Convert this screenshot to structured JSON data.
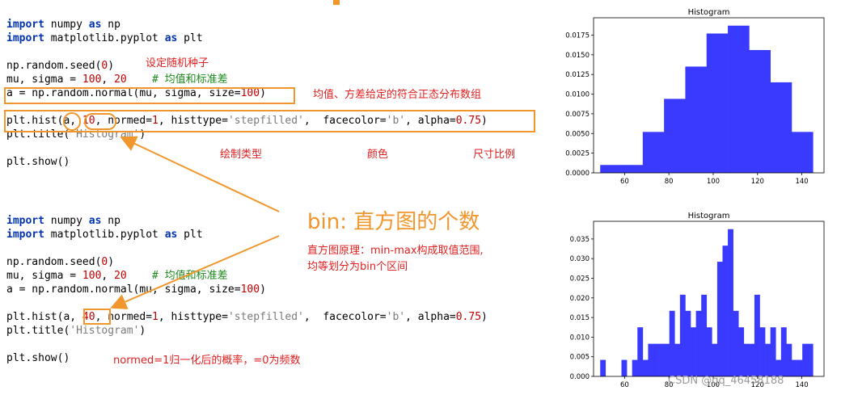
{
  "block1": {
    "lines": [
      {
        "parts": [
          {
            "t": "import",
            "c": "kw"
          },
          {
            "t": " numpy "
          },
          {
            "t": "as",
            "c": "kw"
          },
          {
            "t": " np"
          }
        ]
      },
      {
        "parts": [
          {
            "t": "import",
            "c": "kw"
          },
          {
            "t": " matplotlib.pyplot "
          },
          {
            "t": "as",
            "c": "kw"
          },
          {
            "t": " plt"
          }
        ]
      },
      {
        "parts": []
      },
      {
        "parts": [
          {
            "t": "np.random.seed("
          },
          {
            "t": "0",
            "c": "num"
          },
          {
            "t": ")"
          }
        ]
      },
      {
        "parts": [
          {
            "t": "mu, sigma = "
          },
          {
            "t": "100",
            "c": "num"
          },
          {
            "t": ", "
          },
          {
            "t": "20",
            "c": "num"
          },
          {
            "t": "    "
          },
          {
            "t": "# 均值和标准差",
            "c": "cm"
          }
        ]
      },
      {
        "parts": [
          {
            "t": "a = np.random.normal(mu, sigma, size="
          },
          {
            "t": "100",
            "c": "num"
          },
          {
            "t": ")"
          }
        ]
      },
      {
        "parts": []
      },
      {
        "parts": [
          {
            "t": "plt.hist(a, "
          },
          {
            "t": "10",
            "c": "num"
          },
          {
            "t": ", normed="
          },
          {
            "t": "1",
            "c": "num"
          },
          {
            "t": ", histtype="
          },
          {
            "t": "'stepfilled'",
            "c": "str"
          },
          {
            "t": ",  facecolor="
          },
          {
            "t": "'b'",
            "c": "str"
          },
          {
            "t": ", alpha="
          },
          {
            "t": "0.75",
            "c": "num"
          },
          {
            "t": ")"
          }
        ]
      },
      {
        "parts": [
          {
            "t": "plt.title("
          },
          {
            "t": "'Histogram'",
            "c": "str"
          },
          {
            "t": ")"
          }
        ]
      },
      {
        "parts": []
      },
      {
        "parts": [
          {
            "t": "plt.show()"
          }
        ]
      }
    ]
  },
  "block2": {
    "lines": [
      {
        "parts": [
          {
            "t": "import",
            "c": "kw"
          },
          {
            "t": " numpy "
          },
          {
            "t": "as",
            "c": "kw"
          },
          {
            "t": " np"
          }
        ]
      },
      {
        "parts": [
          {
            "t": "import",
            "c": "kw"
          },
          {
            "t": " matplotlib.pyplot "
          },
          {
            "t": "as",
            "c": "kw"
          },
          {
            "t": " plt"
          }
        ]
      },
      {
        "parts": []
      },
      {
        "parts": [
          {
            "t": "np.random.seed("
          },
          {
            "t": "0",
            "c": "num"
          },
          {
            "t": ")"
          }
        ]
      },
      {
        "parts": [
          {
            "t": "mu, sigma = "
          },
          {
            "t": "100",
            "c": "num"
          },
          {
            "t": ", "
          },
          {
            "t": "20",
            "c": "num"
          },
          {
            "t": "    "
          },
          {
            "t": "# 均值和标准差",
            "c": "cm"
          }
        ]
      },
      {
        "parts": [
          {
            "t": "a = np.random.normal(mu, sigma, size="
          },
          {
            "t": "100",
            "c": "num"
          },
          {
            "t": ")"
          }
        ]
      },
      {
        "parts": []
      },
      {
        "parts": [
          {
            "t": "plt.hist(a, "
          },
          {
            "t": "40",
            "c": "num"
          },
          {
            "t": ", normed="
          },
          {
            "t": "1",
            "c": "num"
          },
          {
            "t": ", histtype="
          },
          {
            "t": "'stepfilled'",
            "c": "str"
          },
          {
            "t": ",  facecolor="
          },
          {
            "t": "'b'",
            "c": "str"
          },
          {
            "t": ", alpha="
          },
          {
            "t": "0.75",
            "c": "num"
          },
          {
            "t": ")"
          }
        ]
      },
      {
        "parts": [
          {
            "t": "plt.title("
          },
          {
            "t": "'Histogram'",
            "c": "str"
          },
          {
            "t": ")"
          }
        ]
      },
      {
        "parts": []
      },
      {
        "parts": [
          {
            "t": "plt.show()"
          }
        ]
      }
    ]
  },
  "annotations": {
    "seed": "设定随机种子",
    "normal": "均值、方差给定的符合正态分布数组",
    "histtype": "绘制类型",
    "color": "颜色",
    "alpha": "尺寸比例",
    "bins_title": "bin: 直方图的个数",
    "bins_desc_1": "直方图原理：min-max构成取值范围,",
    "bins_desc_2": "均等划分为bin个区间",
    "normed": "normed=1归一化后的概率，=0为频数"
  },
  "watermark": "CSDN @qq_46458188",
  "colors": {
    "accent": "#f0962c",
    "note": "#e02020",
    "bar": "#3a3aff"
  },
  "chart_data": [
    {
      "type": "bar",
      "title": "Histogram",
      "xlim": [
        46,
        150
      ],
      "ylim": [
        0,
        0.0197
      ],
      "xticks": [
        60,
        80,
        100,
        120,
        140
      ],
      "yticks": [
        0.0,
        0.0025,
        0.005,
        0.0075,
        0.01,
        0.0125,
        0.015,
        0.0175
      ],
      "ytick_labels": [
        "0.0000",
        "0.0025",
        "0.0050",
        "0.0075",
        "0.0100",
        "0.0125",
        "0.0150",
        "0.0175"
      ],
      "bin_edges": [
        49.0,
        58.6,
        68.2,
        77.8,
        87.4,
        97.0,
        106.6,
        116.2,
        125.8,
        135.4,
        145.0
      ],
      "values": [
        0.001,
        0.001,
        0.0052,
        0.0094,
        0.0135,
        0.0177,
        0.0187,
        0.0156,
        0.0115,
        0.0052
      ]
    },
    {
      "type": "bar",
      "title": "Histogram",
      "xlim": [
        46,
        150
      ],
      "ylim": [
        0,
        0.0395
      ],
      "xticks": [
        60,
        80,
        100,
        120,
        140
      ],
      "yticks": [
        0.0,
        0.005,
        0.01,
        0.015,
        0.02,
        0.025,
        0.03,
        0.035
      ],
      "ytick_labels": [
        "0.000",
        "0.005",
        "0.010",
        "0.015",
        "0.020",
        "0.025",
        "0.030",
        "0.035"
      ],
      "bin_edges": [
        49.0,
        51.4,
        53.8,
        56.2,
        58.6,
        61.0,
        63.4,
        65.8,
        68.2,
        70.6,
        73.0,
        75.4,
        77.8,
        80.2,
        82.6,
        85.0,
        87.4,
        89.8,
        92.2,
        94.6,
        97.0,
        99.4,
        101.8,
        104.2,
        106.6,
        109.0,
        111.4,
        113.8,
        116.2,
        118.6,
        121.0,
        123.4,
        125.8,
        128.2,
        130.6,
        133.0,
        135.4,
        137.8,
        140.2,
        142.6,
        145.0
      ],
      "values": [
        0.0042,
        0,
        0,
        0,
        0.0042,
        0,
        0.0042,
        0.0125,
        0.0042,
        0.0083,
        0.0083,
        0.0083,
        0.0083,
        0.0167,
        0.0083,
        0.0208,
        0.0167,
        0.0125,
        0.0167,
        0.0208,
        0.0125,
        0.0083,
        0.0292,
        0.0333,
        0.0375,
        0.0167,
        0.0125,
        0.0083,
        0.0083,
        0.0208,
        0.0125,
        0.0083,
        0.0125,
        0.0042,
        0.0125,
        0.0083,
        0.0042,
        0.0042,
        0.0083,
        0.0083
      ]
    }
  ]
}
